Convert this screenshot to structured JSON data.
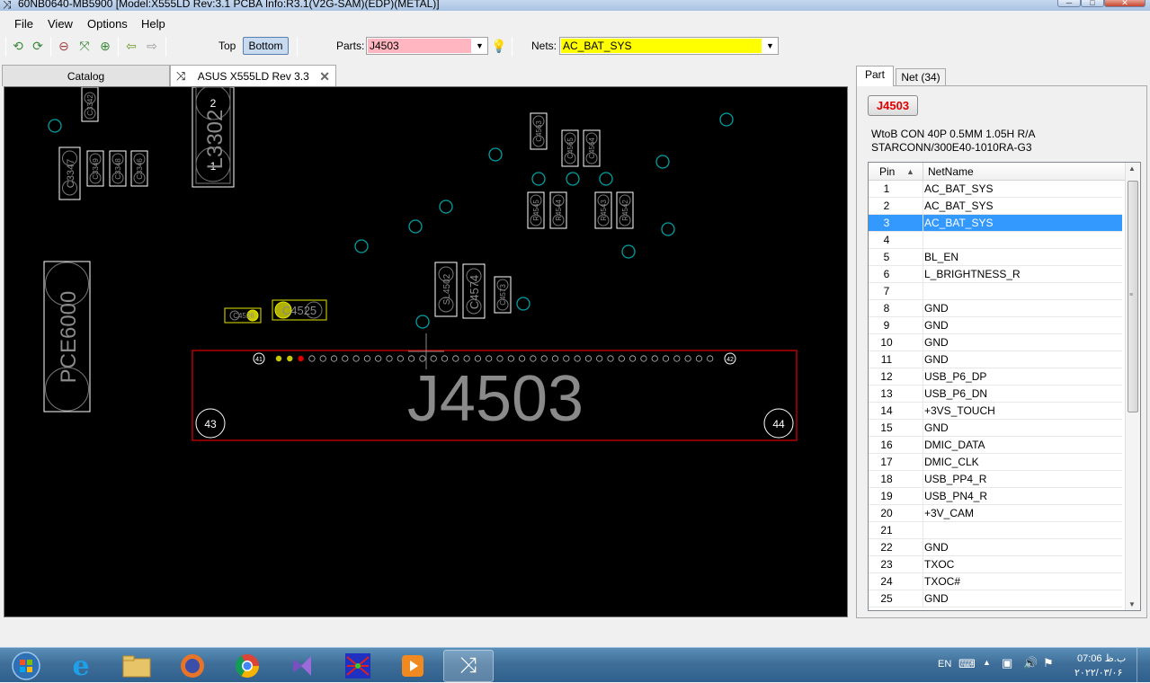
{
  "window": {
    "title": "60NB0640-MB5900 [Model:X555LD Rev:3.1 PCBA Info:R3.1(V2G-SAM)(EDP)(METAL)]",
    "min_label": "─",
    "max_label": "□",
    "close_label": "✕"
  },
  "menu": {
    "items": [
      "File",
      "View",
      "Options",
      "Help"
    ]
  },
  "toolbar": {
    "top_label": "Top",
    "bottom_label": "Bottom",
    "parts_label": "Parts:",
    "parts_value": "J4503",
    "parts_bg": "#ffb6c1",
    "nets_label": "Nets:",
    "nets_value": "AC_BAT_SYS",
    "nets_bg": "#ffff00"
  },
  "doc_tabs": {
    "catalog": "Catalog",
    "board": "ASUS X555LD Rev 3.3"
  },
  "board_view": {
    "colors": {
      "background": "#000000",
      "via": "#00a0a0",
      "outline": "#ffffff",
      "selected": "#e00000",
      "highlight": "#ffff00",
      "label": "#8a8a8a"
    },
    "connector_label": "J4503",
    "corner_pins": {
      "top_left": "41",
      "top_right": "42",
      "bottom_left": "43",
      "bottom_right": "44"
    },
    "part_labels": {
      "pce6000": "PCE6000",
      "c3347": "C3347",
      "c3349": "C3349",
      "c3348": "C3348",
      "c3346": "C3346",
      "c3342": "C3342",
      "l3302": "L3302",
      "l3302_pin2": "2",
      "l3302_pin1": "1",
      "c4526": "C4526",
      "c4525": "C4525",
      "sl4502": "SL4502",
      "c4574": "C4574",
      "c4573": "C4573",
      "c4563": "C4563",
      "c4565": "C4565",
      "c4564": "C4564",
      "r4545": "R4545",
      "r4544": "R4544",
      "r4543": "R4543",
      "r4542": "R4542"
    }
  },
  "part_panel": {
    "tab_part": "Part",
    "tab_net": "Net (34)",
    "part_name": "J4503",
    "description_line1": "WtoB CON 40P 0.5MM 1.05H R/A",
    "description_line2": "STARCONN/300E40-1010RA-G3",
    "grid_header_pin": "Pin",
    "grid_header_net": "NetName",
    "sort_icon": "▲",
    "selected_pin": "3",
    "rows": [
      {
        "pin": "1",
        "net": "AC_BAT_SYS"
      },
      {
        "pin": "2",
        "net": "AC_BAT_SYS"
      },
      {
        "pin": "3",
        "net": "AC_BAT_SYS"
      },
      {
        "pin": "4",
        "net": ""
      },
      {
        "pin": "5",
        "net": "BL_EN"
      },
      {
        "pin": "6",
        "net": "L_BRIGHTNESS_R"
      },
      {
        "pin": "7",
        "net": ""
      },
      {
        "pin": "8",
        "net": "GND"
      },
      {
        "pin": "9",
        "net": "GND"
      },
      {
        "pin": "10",
        "net": "GND"
      },
      {
        "pin": "11",
        "net": "GND"
      },
      {
        "pin": "12",
        "net": "USB_P6_DP"
      },
      {
        "pin": "13",
        "net": "USB_P6_DN"
      },
      {
        "pin": "14",
        "net": "+3VS_TOUCH"
      },
      {
        "pin": "15",
        "net": "GND"
      },
      {
        "pin": "16",
        "net": "DMIC_DATA"
      },
      {
        "pin": "17",
        "net": "DMIC_CLK"
      },
      {
        "pin": "18",
        "net": "USB_PP4_R"
      },
      {
        "pin": "19",
        "net": "USB_PN4_R"
      },
      {
        "pin": "20",
        "net": "+3V_CAM"
      },
      {
        "pin": "21",
        "net": ""
      },
      {
        "pin": "22",
        "net": "GND"
      },
      {
        "pin": "23",
        "net": "TXOC"
      },
      {
        "pin": "24",
        "net": "TXOC#"
      },
      {
        "pin": "25",
        "net": "GND"
      }
    ]
  },
  "taskbar": {
    "lang": "EN",
    "time": "07:06 ب.ظ",
    "date": "۲۰۲۲/۰۳/۰۶",
    "apps": [
      "start-orb-icon",
      "internet-explorer-icon",
      "file-explorer-icon",
      "firefox-icon",
      "chrome-icon",
      "visual-studio-icon",
      "net-graph-app-icon",
      "media-player-icon",
      "boardviewer-app-icon"
    ]
  }
}
